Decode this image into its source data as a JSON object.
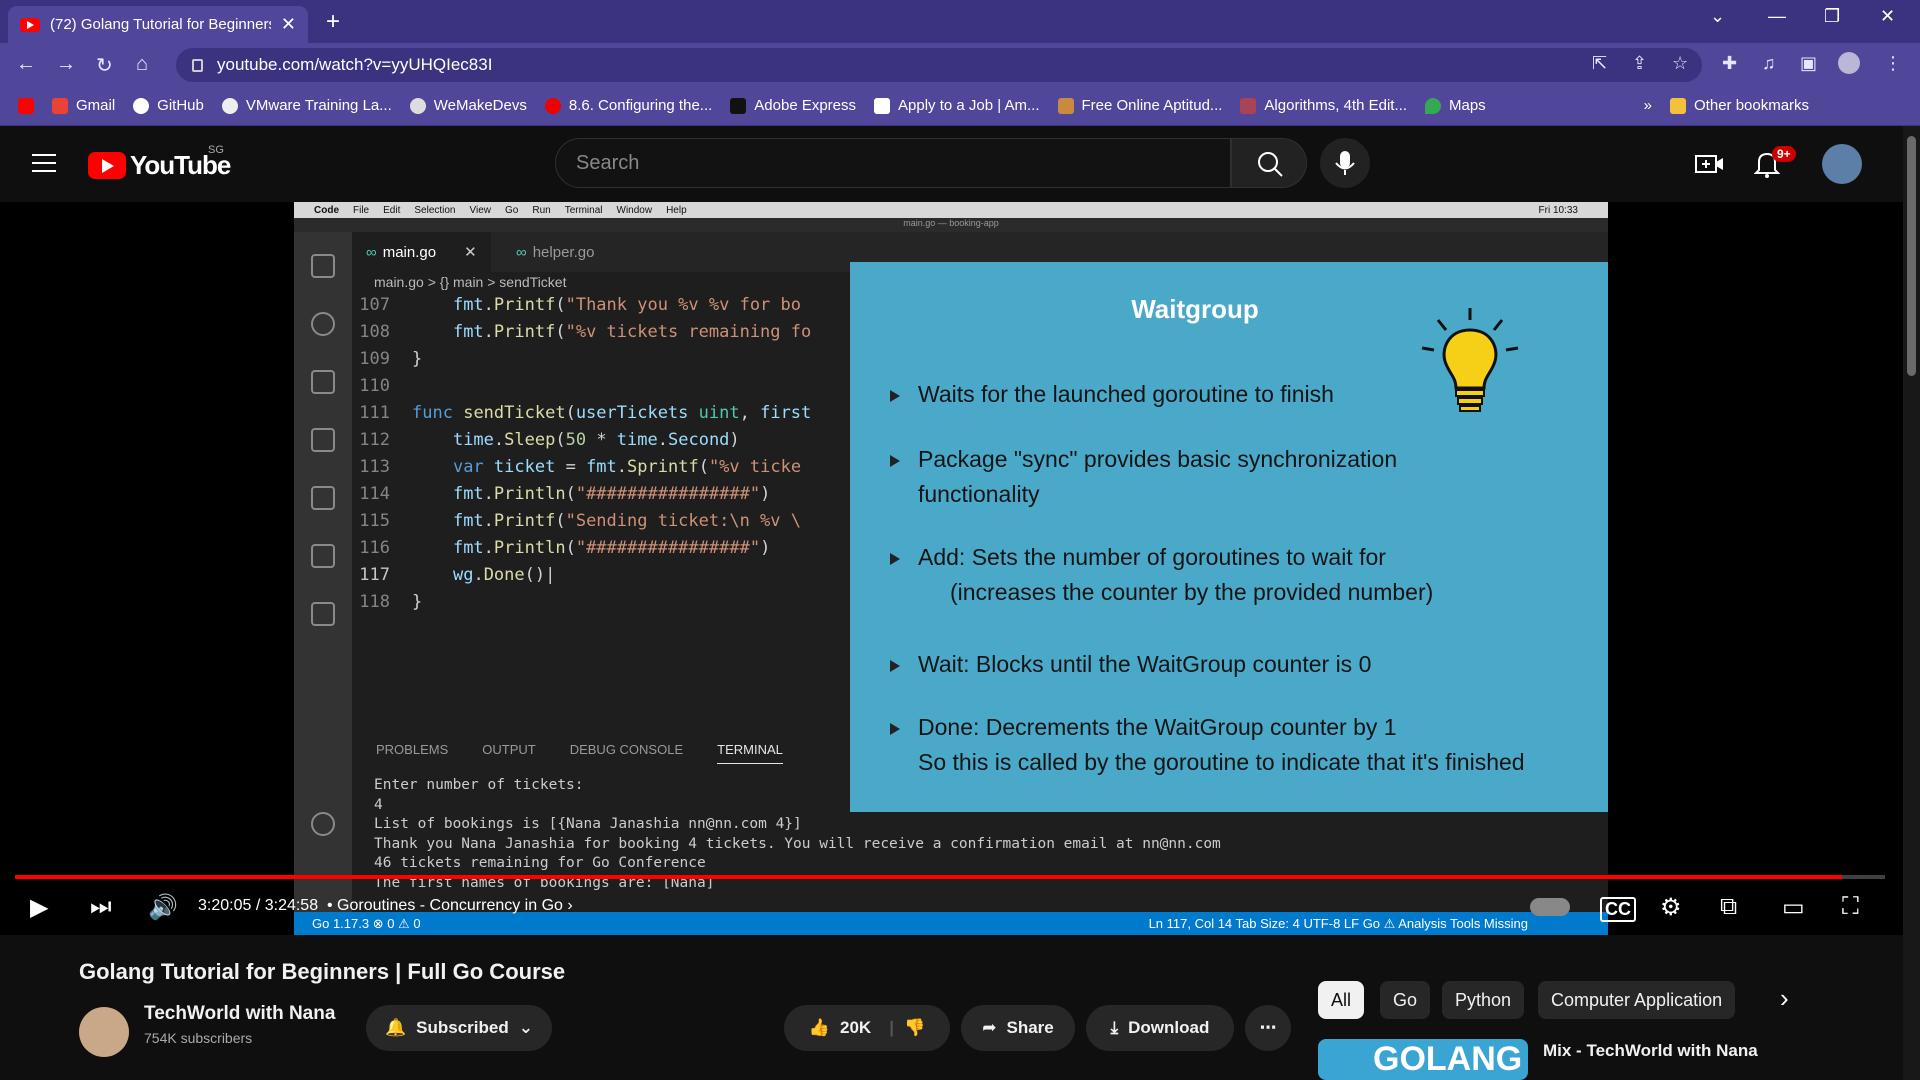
{
  "browser": {
    "tab_title": "(72) Golang Tutorial for Beginners",
    "url": "youtube.com/watch?v=yyUHQIec83I",
    "bookmarks": [
      "Gmail",
      "GitHub",
      "VMware Training La...",
      "WeMakeDevs",
      "8.6. Configuring the...",
      "Adobe Express",
      "Apply to a Job | Am...",
      "Free Online Aptitud...",
      "Algorithms, 4th Edit...",
      "Maps"
    ],
    "other_bookmarks": "Other bookmarks"
  },
  "youtube": {
    "logo_text": "YouTube",
    "region": "SG",
    "search_placeholder": "Search",
    "notifications": "9+"
  },
  "vscode": {
    "menu": [
      "Code",
      "File",
      "Edit",
      "Selection",
      "View",
      "Go",
      "Run",
      "Terminal",
      "Window",
      "Help"
    ],
    "clock": "Fri 10:33",
    "window_title": "main.go — booking-app",
    "tabs": [
      "main.go",
      "helper.go"
    ],
    "breadcrumb": "main.go > {} main > sendTicket",
    "panel_tabs": [
      "PROBLEMS",
      "OUTPUT",
      "DEBUG CONSOLE",
      "TERMINAL"
    ],
    "terminal": "Enter number of tickets:\n4\nList of bookings is [{Nana Janashia nn@nn.com 4}]\nThank you Nana Janashia for booking 4 tickets. You will receive a confirmation email at nn@nn.com\n46 tickets remaining for Go Conference\nThe first names of bookings are: [Nana]",
    "status_left": "Go 1.17.3   ⊗ 0 ⚠ 0",
    "status_right": "Ln 117, Col 14   Tab Size: 4   UTF-8   LF   Go   ⚠ Analysis Tools Missing"
  },
  "slide": {
    "title": "Waitgroup",
    "b1": "Waits for the launched goroutine to finish",
    "b2a": "Package \"sync\" provides basic synchronization",
    "b2b": "functionality",
    "b3a": "Add: Sets the number of goroutines to wait for",
    "b3b": "(increases the counter by the provided number)",
    "b4": "Wait: Blocks until the WaitGroup counter is 0",
    "b5a": "Done: Decrements the WaitGroup counter by 1",
    "b5b": "So this is called by the goroutine to indicate that it's finished"
  },
  "player": {
    "time": "3:20:05 / 3:24:58",
    "chapter": "• Goroutines - Concurrency in Go",
    "progress": 0.977
  },
  "video": {
    "title": "Golang Tutorial for Beginners | Full Go Course",
    "channel": "TechWorld with Nana",
    "subscribers": "754K subscribers",
    "subscribed": "Subscribed",
    "likes": "20K",
    "share": "Share",
    "download": "Download"
  },
  "chips": [
    "All",
    "Go",
    "Python",
    "Computer Application"
  ],
  "related": {
    "thumb_text": "GOLANG",
    "title": "Mix - TechWorld with Nana"
  }
}
